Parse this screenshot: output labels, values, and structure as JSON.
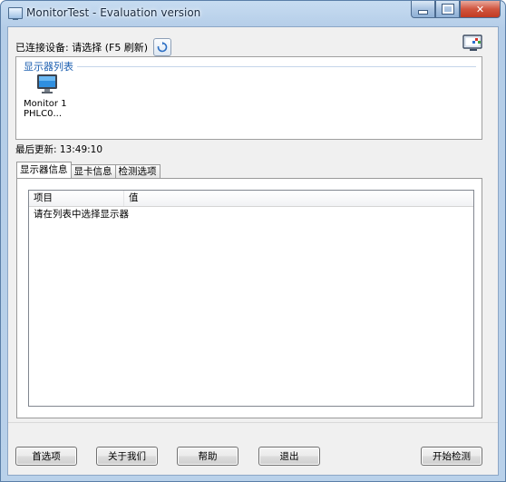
{
  "window": {
    "title": "MonitorTest - Evaluation version"
  },
  "toolbar": {
    "connected_label": "已连接设备: 请选择 (F5 刷新)",
    "refresh_icon": "refresh-icon",
    "display_settings_icon": "display-settings-icon"
  },
  "monitor_list": {
    "title": "显示器列表",
    "items": [
      {
        "name": "Monitor 1",
        "model": "PHLC0...",
        "icon": "monitor-icon"
      }
    ]
  },
  "status": {
    "last_update": "最后更新: 13:49:10"
  },
  "tabs": [
    {
      "label": "显示器信息",
      "active": true
    },
    {
      "label": "显卡信息",
      "active": false
    },
    {
      "label": "检测选项",
      "active": false
    }
  ],
  "info_table": {
    "columns": [
      "项目",
      "值"
    ],
    "rows": [
      [
        "请在列表中选择显示器",
        ""
      ]
    ]
  },
  "buttons": {
    "preferences": "首选项",
    "about": "关于我们",
    "help": "帮助",
    "exit": "退出",
    "start_test": "开始检测"
  },
  "colors": {
    "group_title": "#1c5fb0",
    "close_button": "#c23a22"
  }
}
